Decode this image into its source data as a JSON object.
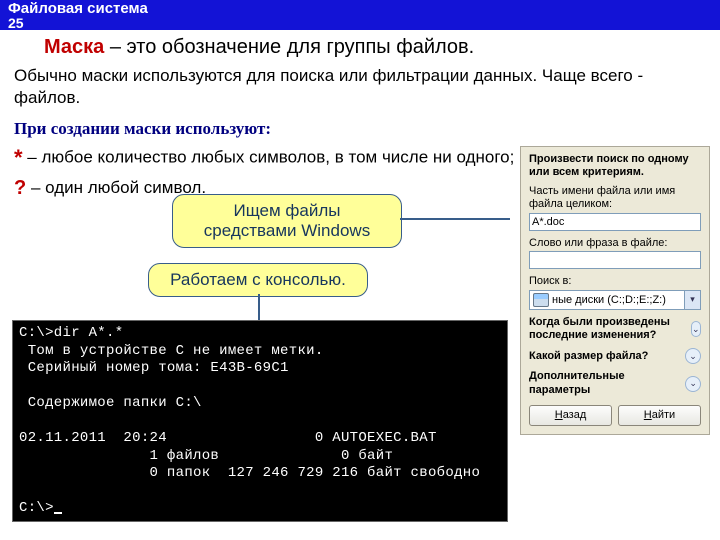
{
  "header": {
    "title": "Файловая система",
    "page": "25"
  },
  "title": {
    "word": "Маска",
    "rest": " – это обозначение для группы файлов."
  },
  "desc": "Обычно маски используются для поиска или фильтрации данных. Чаще всего - файлов.",
  "rules": {
    "heading": "При создании маски используют:",
    "star_sym": "*",
    "star_text": " – любое количество любых символов, в том числе ни одного;",
    "q_sym": "?",
    "q_text": " – один любой символ."
  },
  "callouts": {
    "windows": "Ищем файлы средствами Windows",
    "console": "Работаем с консолью."
  },
  "search": {
    "heading": "Произвести поиск по одному или всем критериям.",
    "name_label": "Часть имени файла или имя файла целиком:",
    "name_value": "A*.doc",
    "phrase_label": "Слово или фраза в файле:",
    "phrase_value": "",
    "lookin_label": "Поиск в:",
    "lookin_value": "ные диски (C:;D:;E:;Z:)",
    "exp1": "Когда были произведены последние изменения?",
    "exp2": "Какой размер файла?",
    "exp3": "Дополнительные параметры",
    "back_u": "Н",
    "back_rest": "азад",
    "find_u": "Н",
    "find_rest": "айти"
  },
  "console": {
    "l1": "C:\\>dir A*.*",
    "l2": " Том в устройстве C не имеет метки.",
    "l3": " Серийный номер тома: E43B-69C1",
    "l4": "",
    "l5": " Содержимое папки C:\\",
    "l6": "",
    "l7": "02.11.2011  20:24                 0 AUTOEXEC.BAT",
    "l8": "               1 файлов              0 байт",
    "l9": "               0 папок  127 246 729 216 байт свободно",
    "l10": "",
    "l11": "C:\\>"
  }
}
